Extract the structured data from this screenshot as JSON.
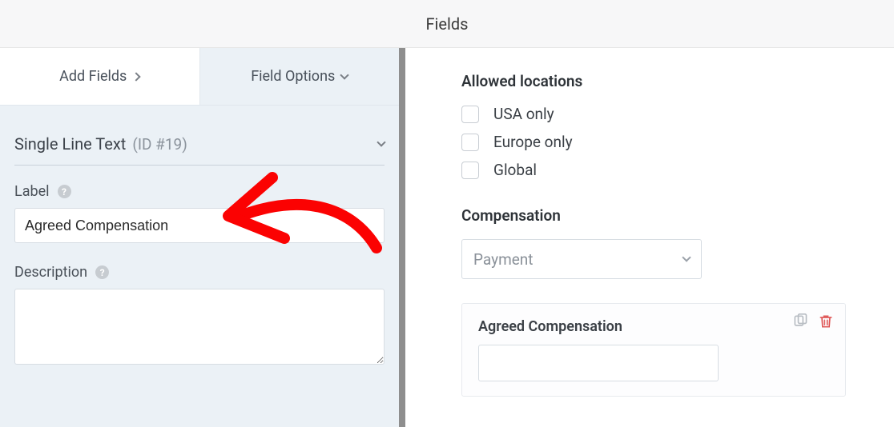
{
  "header": {
    "title": "Fields"
  },
  "tabs": {
    "add_fields": "Add Fields",
    "field_options": "Field Options"
  },
  "field_info": {
    "type_title": "Single Line Text",
    "id_text": "(ID #19)"
  },
  "form": {
    "label_caption": "Label",
    "label_value": "Agreed Compensation",
    "description_caption": "Description",
    "description_value": ""
  },
  "allowed_locations": {
    "title": "Allowed locations",
    "options": [
      "USA only",
      "Europe only",
      "Global"
    ]
  },
  "compensation": {
    "title": "Compensation",
    "placeholder": "Payment"
  },
  "preview_field": {
    "label": "Agreed Compensation"
  },
  "help_char": "?"
}
